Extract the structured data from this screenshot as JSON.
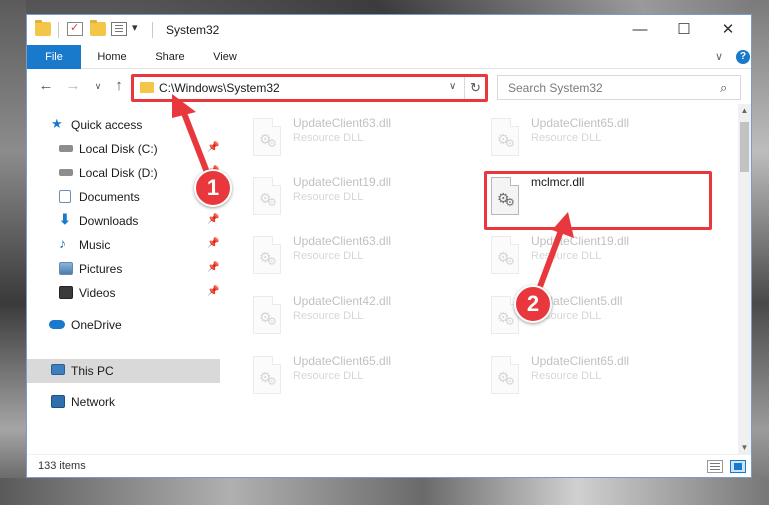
{
  "window": {
    "title": "System32",
    "minimize": "—",
    "maximize": "☐",
    "close": "✕"
  },
  "ribbon": {
    "tabs": [
      "File",
      "Home",
      "Share",
      "View"
    ],
    "chevron": "∨",
    "help": "?"
  },
  "nav": {
    "back": "←",
    "forward": "→",
    "recent": "∨",
    "up": "↑",
    "address": "C:\\Windows\\System32",
    "address_dropdown": "∨",
    "refresh": "↻",
    "search_placeholder": "Search System32",
    "search_icon": "⌕"
  },
  "sidebar": {
    "items": [
      {
        "label": "Quick access",
        "icon": "star-icon",
        "pinned": false
      },
      {
        "label": "Local Disk (C:)",
        "icon": "drive-icon",
        "pinned": true
      },
      {
        "label": "Local Disk (D:)",
        "icon": "drive-icon",
        "pinned": true
      },
      {
        "label": "Documents",
        "icon": "documents-icon",
        "pinned": true
      },
      {
        "label": "Downloads",
        "icon": "download-icon",
        "pinned": true
      },
      {
        "label": "Music",
        "icon": "music-icon",
        "pinned": true
      },
      {
        "label": "Pictures",
        "icon": "pictures-icon",
        "pinned": true
      },
      {
        "label": "Videos",
        "icon": "videos-icon",
        "pinned": true
      },
      {
        "label": "OneDrive",
        "icon": "cloud-icon",
        "pinned": false
      },
      {
        "label": "This PC",
        "icon": "computer-icon",
        "pinned": false,
        "selected": true
      },
      {
        "label": "Network",
        "icon": "network-icon",
        "pinned": false
      }
    ]
  },
  "files": [
    {
      "name": "UpdateClient63.dll",
      "type": "Resource DLL",
      "faded": true
    },
    {
      "name": "UpdateClient65.dll",
      "type": "Resource DLL",
      "faded": true
    },
    {
      "name": "UpdateClient19.dll",
      "type": "Resource DLL",
      "faded": true
    },
    {
      "name": "mclmcr.dll",
      "type": "",
      "faded": false
    },
    {
      "name": "UpdateClient63.dll",
      "type": "Resource DLL",
      "faded": true
    },
    {
      "name": "UpdateClient19.dll",
      "type": "Resource DLL",
      "faded": true
    },
    {
      "name": "UpdateClient42.dll",
      "type": "Resource DLL",
      "faded": true
    },
    {
      "name": "UpdateClient5.dll",
      "type": "Resource DLL",
      "faded": true
    },
    {
      "name": "UpdateClient65.dll",
      "type": "Resource DLL",
      "faded": true
    },
    {
      "name": "UpdateClient65.dll",
      "type": "Resource DLL",
      "faded": true
    }
  ],
  "status": {
    "item_count": "133 items"
  },
  "annotations": {
    "step1": "1",
    "step2": "2",
    "color": "#e8383d"
  }
}
